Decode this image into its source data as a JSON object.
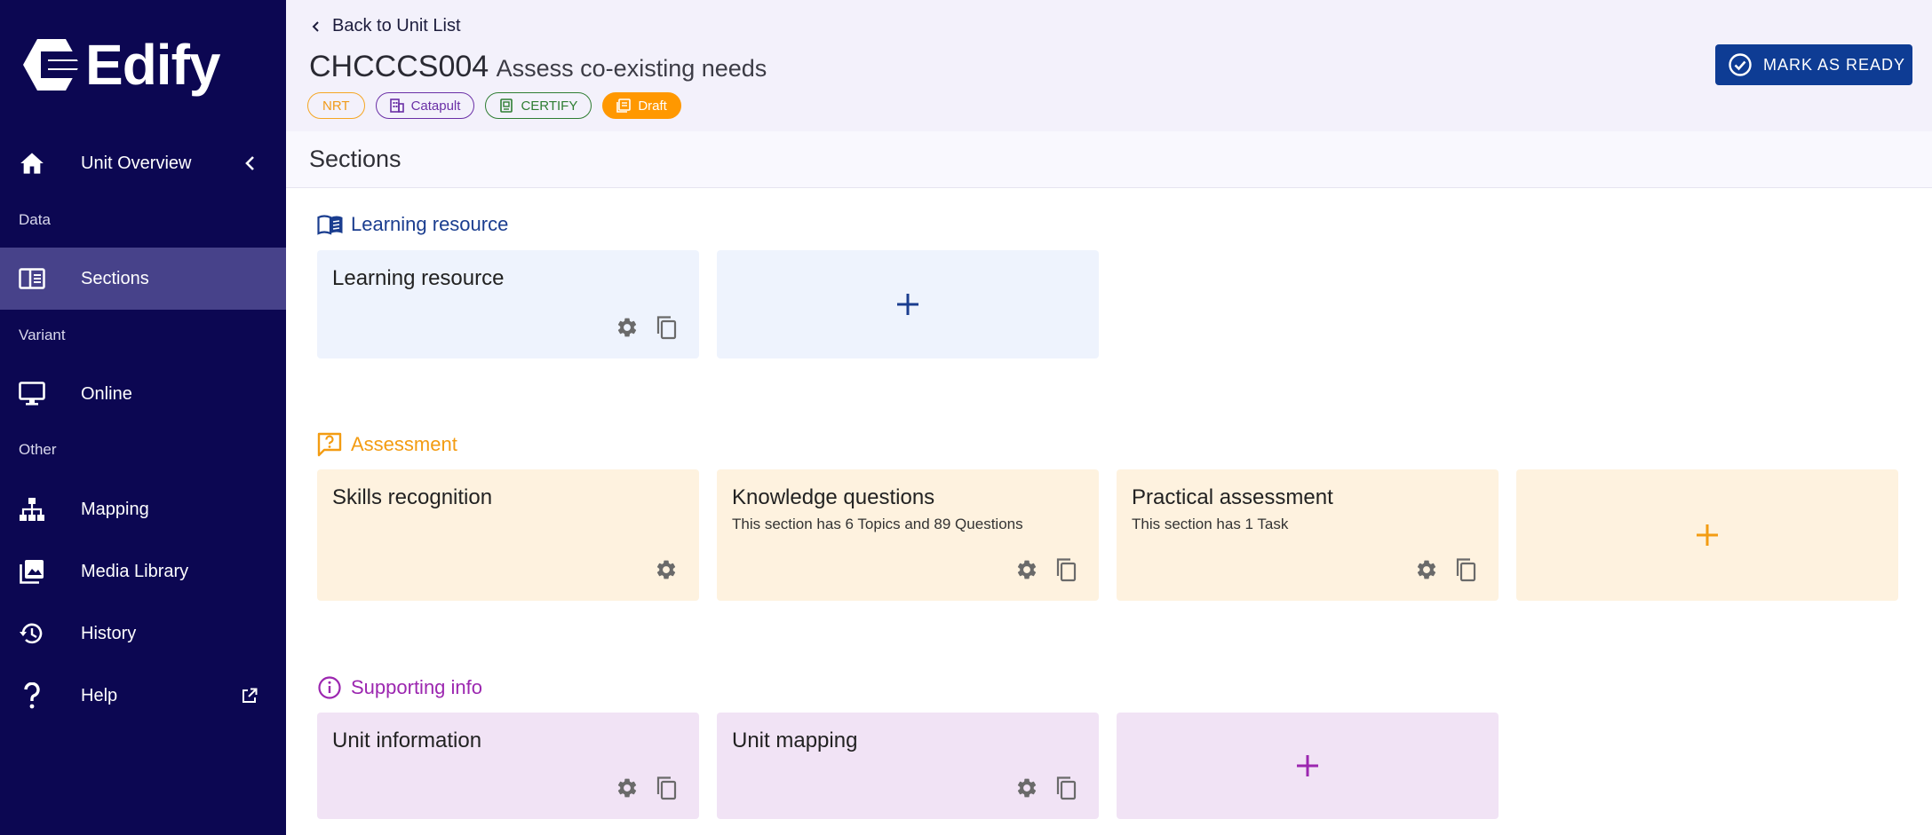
{
  "sidebar": {
    "logo_text": "Edify",
    "nav": {
      "unit_overview": "Unit Overview",
      "section_data": "Data",
      "sections": "Sections",
      "section_variant": "Variant",
      "online": "Online",
      "section_other": "Other",
      "mapping": "Mapping",
      "media_library": "Media Library",
      "history": "History",
      "help": "Help"
    }
  },
  "header": {
    "back_label": "Back to Unit List",
    "unit_code": "CHCCCS004",
    "unit_name": "Assess co-existing needs",
    "badges": {
      "nrt": "NRT",
      "catapult": "Catapult",
      "certify": "CERTIFY",
      "draft": "Draft"
    },
    "mark_ready_label": "MARK AS READY"
  },
  "sections_title": "Sections",
  "groups": {
    "learning_resource": {
      "title": "Learning resource",
      "cards": [
        {
          "title": "Learning resource"
        }
      ]
    },
    "assessment": {
      "title": "Assessment",
      "cards": [
        {
          "title": "Skills recognition"
        },
        {
          "title": "Knowledge questions",
          "subtitle": "This section has 6 Topics and 89 Questions"
        },
        {
          "title": "Practical assessment",
          "subtitle": "This section has 1 Task"
        }
      ]
    },
    "supporting_info": {
      "title": "Supporting info",
      "cards": [
        {
          "title": "Unit information"
        },
        {
          "title": "Unit mapping"
        }
      ]
    }
  },
  "colors": {
    "sidebar_bg": "#0c0752",
    "sidebar_active": "#47428a",
    "primary_blue": "#0e3c94",
    "learning_accent": "#1a3d8f",
    "assessment_accent": "#f39c12",
    "supporting_accent": "#9c27b0"
  }
}
